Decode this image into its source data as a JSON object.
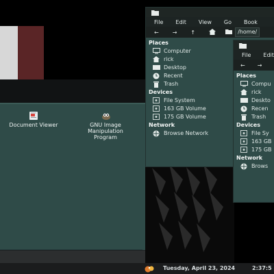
{
  "desktop": {
    "flag_colors": [
      "#d7d7d7",
      "#5a2526"
    ]
  },
  "app_window": {
    "icons": [
      {
        "label": "Document Viewer",
        "icon": "document-viewer-icon"
      },
      {
        "label": "GNU Image Manipulation Program",
        "label_lines": [
          "GNU Image",
          "Manipulation",
          "Program"
        ],
        "icon": "gimp-icon"
      }
    ]
  },
  "file_manager_back": {
    "menu": [
      "File",
      "Edit",
      "View",
      "Go",
      "Book"
    ],
    "path": "/home/",
    "sections": [
      {
        "title": "Places",
        "items": [
          {
            "label": "Computer",
            "icon": "computer-icon"
          },
          {
            "label": "rick",
            "icon": "home-icon"
          },
          {
            "label": "Desktop",
            "icon": "desktop-icon"
          },
          {
            "label": "Recent",
            "icon": "recent-icon"
          },
          {
            "label": "Trash",
            "icon": "trash-icon"
          }
        ]
      },
      {
        "title": "Devices",
        "items": [
          {
            "label": "File System",
            "icon": "drive-icon"
          },
          {
            "label": "163 GB Volume",
            "icon": "drive-icon"
          },
          {
            "label": "175 GB Volume",
            "icon": "drive-icon"
          }
        ]
      },
      {
        "title": "Network",
        "items": [
          {
            "label": "Browse Network",
            "icon": "network-icon"
          }
        ]
      }
    ]
  },
  "file_manager_front": {
    "menu": [
      "File",
      "Edit"
    ],
    "sections": [
      {
        "title": "Places",
        "items": [
          {
            "label": "Compu",
            "icon": "computer-icon"
          },
          {
            "label": "rick",
            "icon": "home-icon"
          },
          {
            "label": "Deskto",
            "icon": "desktop-icon"
          },
          {
            "label": "Recen",
            "icon": "recent-icon"
          },
          {
            "label": "Trash",
            "icon": "trash-icon"
          }
        ]
      },
      {
        "title": "Devices",
        "items": [
          {
            "label": "File Sy",
            "icon": "drive-icon"
          },
          {
            "label": "163 GB",
            "icon": "drive-icon"
          },
          {
            "label": "175 GB",
            "icon": "drive-icon"
          }
        ]
      },
      {
        "title": "Network",
        "items": [
          {
            "label": "Brows",
            "icon": "network-icon"
          }
        ]
      }
    ]
  },
  "taskbar": {
    "date": "Tuesday, April 23, 2024",
    "time": "2:37:5"
  }
}
